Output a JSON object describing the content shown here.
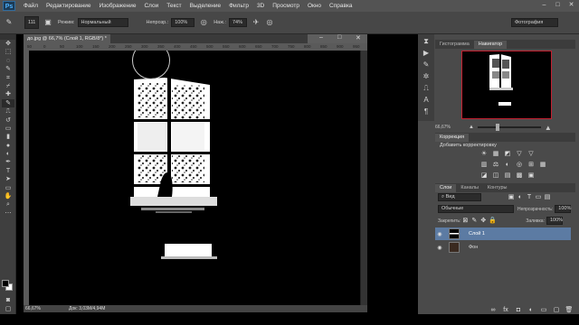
{
  "app": {
    "logo": "Ps",
    "menu": [
      "Файл",
      "Редактирование",
      "Изображение",
      "Слои",
      "Текст",
      "Выделение",
      "Фильтр",
      "3D",
      "Просмотр",
      "Окно",
      "Справка"
    ],
    "window_controls": [
      "–",
      "□",
      "✕"
    ]
  },
  "options": {
    "brush_size": "111",
    "mode_label": "Режим:",
    "mode_value": "Нормальный",
    "opacity_label": "Непрозр.:",
    "opacity_value": "100%",
    "flow_label": "Наж.:",
    "flow_value": "74%",
    "workspace": "Фотография"
  },
  "document": {
    "tab_title": "до.jpg @ 66,7% (Слой 1, RGB/8*) *",
    "ruler_ticks": [
      "50",
      "0",
      "50",
      "100",
      "150",
      "200",
      "250",
      "300",
      "350",
      "400",
      "450",
      "500",
      "550",
      "600",
      "650",
      "700",
      "750",
      "800",
      "850",
      "900",
      "950"
    ],
    "zoom": "66,67%",
    "doc_size": "Док: 3,03M/4,94M"
  },
  "navigator": {
    "tabs": [
      "Гистограмма",
      "Навигатор"
    ],
    "active_tab": "Навигатор",
    "zoom": "66,67%"
  },
  "adjustments": {
    "title": "Коррекция",
    "subtitle": "Добавить корректировку",
    "row1": [
      "☀",
      "▦",
      "◩",
      "▽",
      "▽"
    ],
    "row2": [
      "▥",
      "⚖",
      "◐",
      "◎",
      "⊞",
      "▦"
    ],
    "row3": [
      "◪",
      "◫",
      "▤",
      "▩",
      "▣"
    ]
  },
  "layers": {
    "tabs": [
      "Слои",
      "Каналы",
      "Контуры"
    ],
    "active_tab": "Слои",
    "filter_label": "Вид",
    "blend_mode": "Обычные",
    "opacity_label": "Непрозрачность:",
    "opacity_value": "100%",
    "lock_label": "Закрепить:",
    "fill_label": "Заливка:",
    "fill_value": "100%",
    "items": [
      {
        "name": "Слой 1",
        "selected": true
      },
      {
        "name": "Фон",
        "selected": false
      }
    ]
  },
  "colors": {
    "selected_layer": "#5c7ba3",
    "nav_frame": "#c42030"
  }
}
